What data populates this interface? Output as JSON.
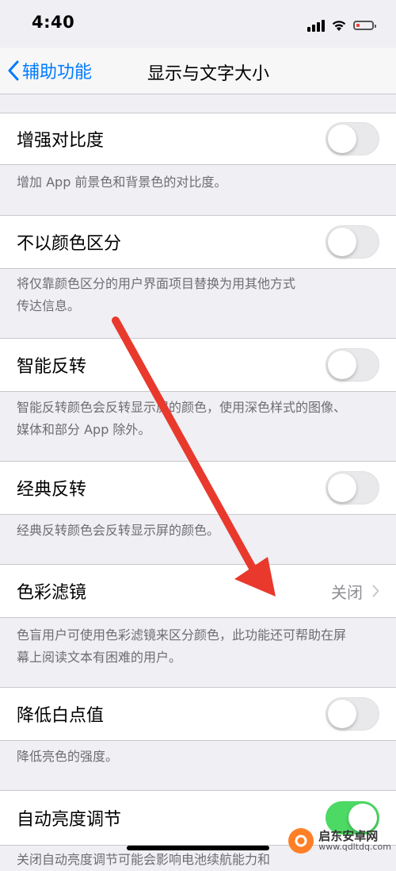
{
  "status": {
    "time": "4:40",
    "battery_color": "#ff3b30"
  },
  "nav": {
    "back_label": "辅助功能",
    "title": "显示与文字大小",
    "accent": "#007aff"
  },
  "settings": [
    {
      "label": "增强对比度",
      "control": "toggle",
      "on": false,
      "footer": "增加 App 前景色和背景色的对比度。"
    },
    {
      "label": "不以颜色区分",
      "control": "toggle",
      "on": false,
      "footer_lines": [
        "将仅靠颜色区分的用户界面项目替换为用其他方式",
        "传达信息。"
      ]
    },
    {
      "label": "智能反转",
      "control": "toggle",
      "on": false,
      "footer_lines": [
        "智能反转颜色会反转显示屏的颜色，使用深色样式的图像、",
        "媒体和部分 App 除外。"
      ]
    },
    {
      "label": "经典反转",
      "control": "toggle",
      "on": false,
      "footer": "经典反转颜色会反转显示屏的颜色。"
    },
    {
      "label": "色彩滤镜",
      "control": "disclosure",
      "value": "关闭",
      "footer_lines": [
        "色盲用户可使用色彩滤镜来区分颜色，此功能还可帮助在屏",
        "幕上阅读文本有困难的用户。"
      ]
    },
    {
      "label": "降低白点值",
      "control": "toggle",
      "on": false,
      "footer": "降低亮色的强度。"
    },
    {
      "label": "自动亮度调节",
      "control": "toggle",
      "on": true,
      "footer": "关闭自动亮度调节可能会影响电池续航能力和"
    }
  ],
  "annotation": {
    "arrow_color": "#e8392c"
  },
  "watermark": {
    "name": "启东安卓网",
    "url": "www.qdltdq.com"
  }
}
